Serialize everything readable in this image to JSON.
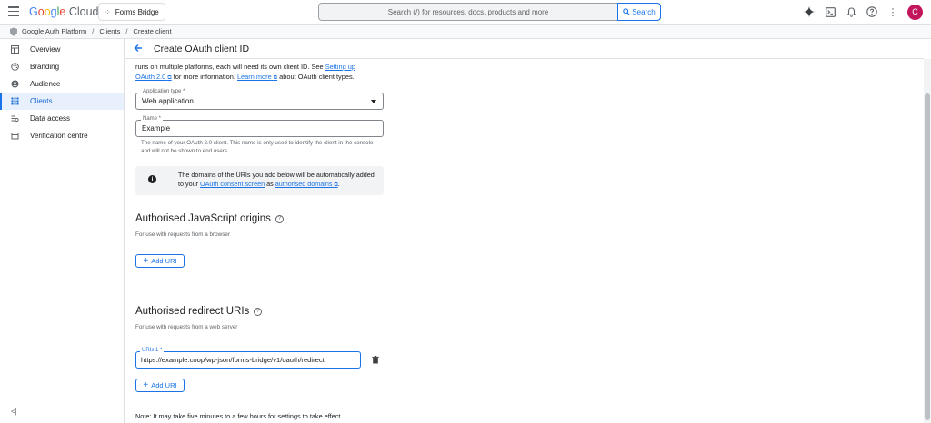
{
  "topbar": {
    "logo_parts": [
      "G",
      "o",
      "o",
      "g",
      "l",
      "e"
    ],
    "logo_suffix": "Cloud",
    "project_name": "Forms Bridge",
    "search_placeholder": "Search (/) for resources, docs, products and more",
    "search_button": "Search",
    "avatar_letter": "C"
  },
  "breadcrumb": {
    "items": [
      "Google Auth Platform",
      "Clients",
      "Create client"
    ]
  },
  "sidebar": {
    "items": [
      {
        "label": "Overview",
        "icon": "dashboard-icon"
      },
      {
        "label": "Branding",
        "icon": "palette-icon"
      },
      {
        "label": "Audience",
        "icon": "person-icon"
      },
      {
        "label": "Clients",
        "icon": "grid-icon"
      },
      {
        "label": "Data access",
        "icon": "data-access-icon"
      },
      {
        "label": "Verification centre",
        "icon": "calendar-icon"
      }
    ],
    "collapse_label": "<|"
  },
  "page": {
    "title": "Create OAuth client ID",
    "intro_text": "runs on multiple platforms, each will need its own client ID. See ",
    "intro_link1": "Setting up",
    "intro_link1b": "OAuth 2.0",
    "intro_mid": " for more information. ",
    "intro_link2": "Learn more",
    "intro_end": " about OAuth client types."
  },
  "form": {
    "app_type_label": "Application type *",
    "app_type_value": "Web application",
    "name_label": "Name *",
    "name_value": "Example",
    "name_helper": "The name of your OAuth 2.0 client. This name is only used to identify the client in the console and will not be shown to end users.",
    "info_text_1": "The domains of the URIs you add below will be automatically added to your ",
    "info_link1": "OAuth consent screen",
    "info_mid": " as ",
    "info_link2": "authorised domains",
    "info_end": "."
  },
  "js_origins": {
    "title": "Authorised JavaScript origins",
    "subtitle": "For use with requests from a browser",
    "add_label": "Add URI"
  },
  "redirect_uris": {
    "title": "Authorised redirect URIs",
    "subtitle": "For use with requests from a web server",
    "field_label": "URIs 1 *",
    "field_value": "https://example.coop/wp-json/forms-bridge/v1/oauth/redirect",
    "add_label": "Add URI"
  },
  "note": "Note: It may take five minutes to a few hours for settings to take effect"
}
